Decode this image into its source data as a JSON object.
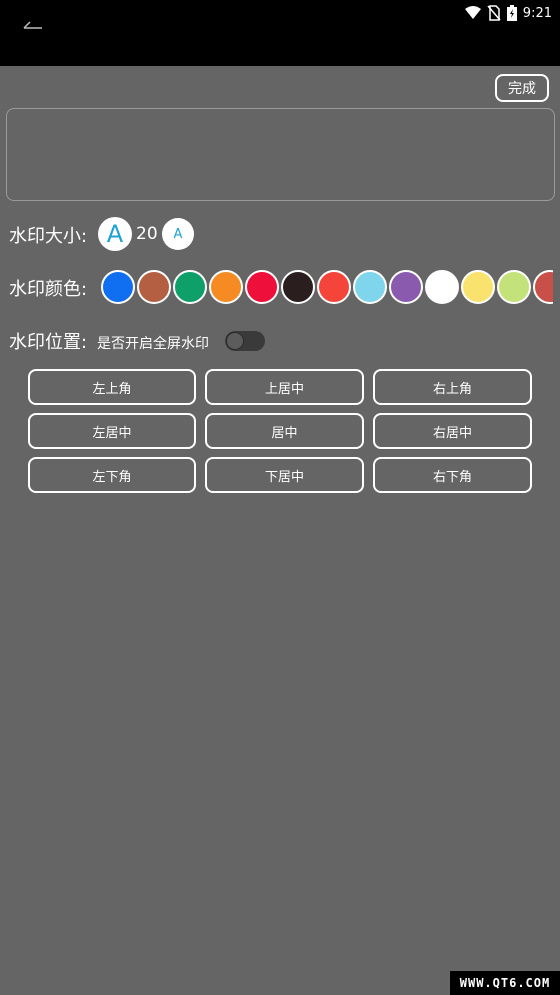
{
  "status_bar": {
    "time": "9:21"
  },
  "toolbar": {
    "done_label": "完成"
  },
  "text_input": {
    "value": ""
  },
  "size": {
    "label": "水印大小:",
    "increase_glyph": "A",
    "decrease_glyph": "A",
    "value": "20"
  },
  "color": {
    "label": "水印颜色:",
    "swatches": [
      "#0f6ff0",
      "#b55f42",
      "#0fa06a",
      "#f58b22",
      "#ef0f3b",
      "#2a1e1e",
      "#f5453a",
      "#7fd5ec",
      "#8a5aae",
      "#ffffff",
      "#f9e36e",
      "#c4e27a",
      "#c95048"
    ]
  },
  "position": {
    "label": "水印位置:",
    "fullscreen_label": "是否开启全屏水印",
    "buttons": [
      "左上角",
      "上居中",
      "右上角",
      "左居中",
      "居中",
      "右居中",
      "左下角",
      "下居中",
      "右下角"
    ]
  },
  "watermark_text": "WWW.QT6.COM"
}
